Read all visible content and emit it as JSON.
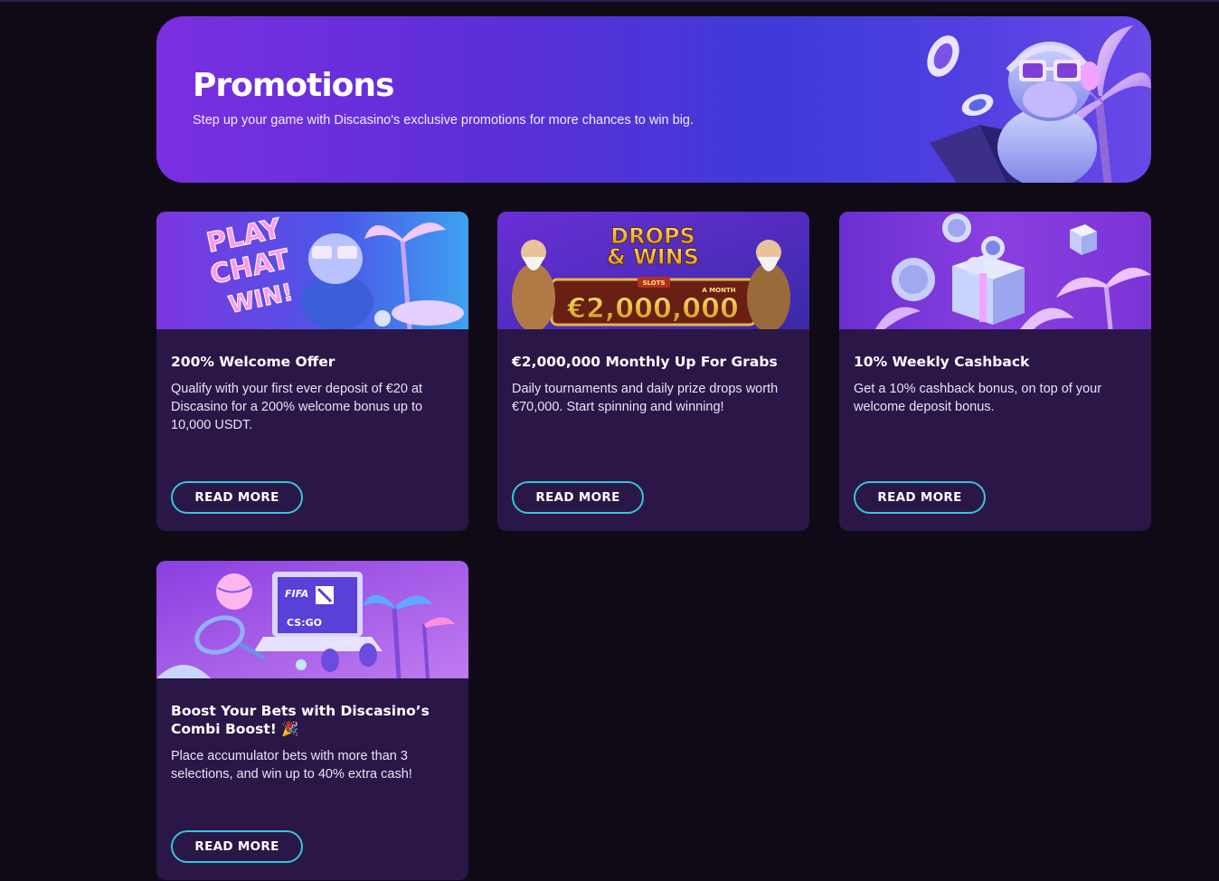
{
  "hero": {
    "title": "Promotions",
    "subtitle": "Step up your game with Discasino's exclusive promotions for more chances to win big."
  },
  "banner_texts": {
    "play": "PLAY",
    "chat": "CHAT",
    "win": "WIN!",
    "drops_line1": "DROPS",
    "drops_line2": "& WINS",
    "slots": "SLOTS",
    "a_month": "A MONTH",
    "amount": "€2,000,000",
    "fifa": "FIFA",
    "csgo": "CS:GO"
  },
  "promotions": [
    {
      "title": "200% Welcome Offer",
      "description": "Qualify with your first ever deposit of €20 at Discasino for a 200% welcome bonus up to 10,000 USDT.",
      "button": "READ MORE"
    },
    {
      "title": "€2,000,000 Monthly Up For Grabs",
      "description": "Daily tournaments and daily prize drops worth €70,000. Start spinning and winning!",
      "button": "READ MORE"
    },
    {
      "title": "10% Weekly Cashback",
      "description": "Get a 10% cashback bonus, on top of your welcome deposit bonus.",
      "button": "READ MORE"
    },
    {
      "title": "Boost Your Bets with Discasino’s Combi Boost! 🎉",
      "description": "Place accumulator bets with more than 3 selections, and win up to 40% extra cash!",
      "button": "READ MORE"
    }
  ],
  "colors": {
    "page_bg": "#0f0a16",
    "card_bg": "#2a1747",
    "button_border": "#35c6d9",
    "hero_gradient_start": "#7a2fe0",
    "hero_gradient_end": "#4f3fe0"
  }
}
